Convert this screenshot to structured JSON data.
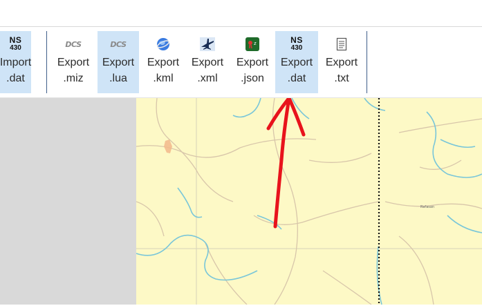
{
  "ribbon": {
    "buttons": [
      {
        "id": "import-dat",
        "icon": "ns430-icon",
        "icon_text": [
          "NS",
          "430"
        ],
        "line1": "Import",
        "line2": ".dat",
        "selected": true
      },
      {
        "id": "export-miz",
        "icon": "dcs-icon",
        "icon_text": [
          "DCS"
        ],
        "line1": "Export",
        "line2": ".miz",
        "selected": false
      },
      {
        "id": "export-lua",
        "icon": "dcs-icon",
        "icon_text": [
          "DCS"
        ],
        "line1": "Export",
        "line2": ".lua",
        "selected": true
      },
      {
        "id": "export-kml",
        "icon": "globe-icon",
        "line1": "Export",
        "line2": ".kml",
        "selected": false
      },
      {
        "id": "export-xml",
        "icon": "jet-icon",
        "line1": "Export",
        "line2": ".xml",
        "selected": false
      },
      {
        "id": "export-json",
        "icon": "green-app-icon",
        "line1": "Export",
        "line2": ".json",
        "selected": false
      },
      {
        "id": "export-dat",
        "icon": "ns430-icon",
        "icon_text": [
          "NS",
          "430"
        ],
        "line1": "Export",
        "line2": ".dat",
        "selected": true
      },
      {
        "id": "export-txt",
        "icon": "text-file-icon",
        "line1": "Export",
        "line2": ".txt",
        "selected": false
      }
    ]
  },
  "map": {
    "background_color": "#fdf9c6",
    "river_color": "#79c6d9",
    "road_color": "#d8c6aa",
    "town_label": "Rafasan",
    "annotation_color": "#e8131c",
    "annotation": "red-arrow-pointing-to-export-dat"
  }
}
